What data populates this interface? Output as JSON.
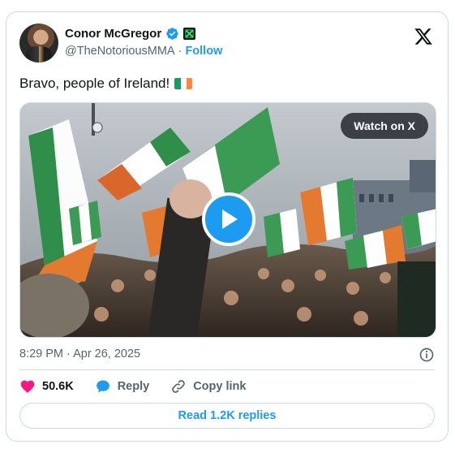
{
  "author": {
    "display_name": "Conor McGregor",
    "handle": "@TheNotoriousMMA",
    "separator": "·",
    "follow_label": "Follow"
  },
  "tweet": {
    "text": "Bravo, people of Ireland!",
    "emoji": "irish-flag-emoji"
  },
  "media": {
    "watch_label": "Watch on X",
    "type": "video"
  },
  "meta": {
    "timestamp": "8:29 PM · Apr 26, 2025"
  },
  "actions": {
    "likes": "50.6K",
    "reply_label": "Reply",
    "copy_link_label": "Copy link"
  },
  "footer": {
    "read_replies_label": "Read 1.2K replies"
  },
  "colors": {
    "accent": "#1d9bf0",
    "like": "#f91880",
    "verified": "#1d9bf0",
    "flag_green": "#169b62",
    "flag_white": "#ffffff",
    "flag_orange": "#ff883e"
  }
}
